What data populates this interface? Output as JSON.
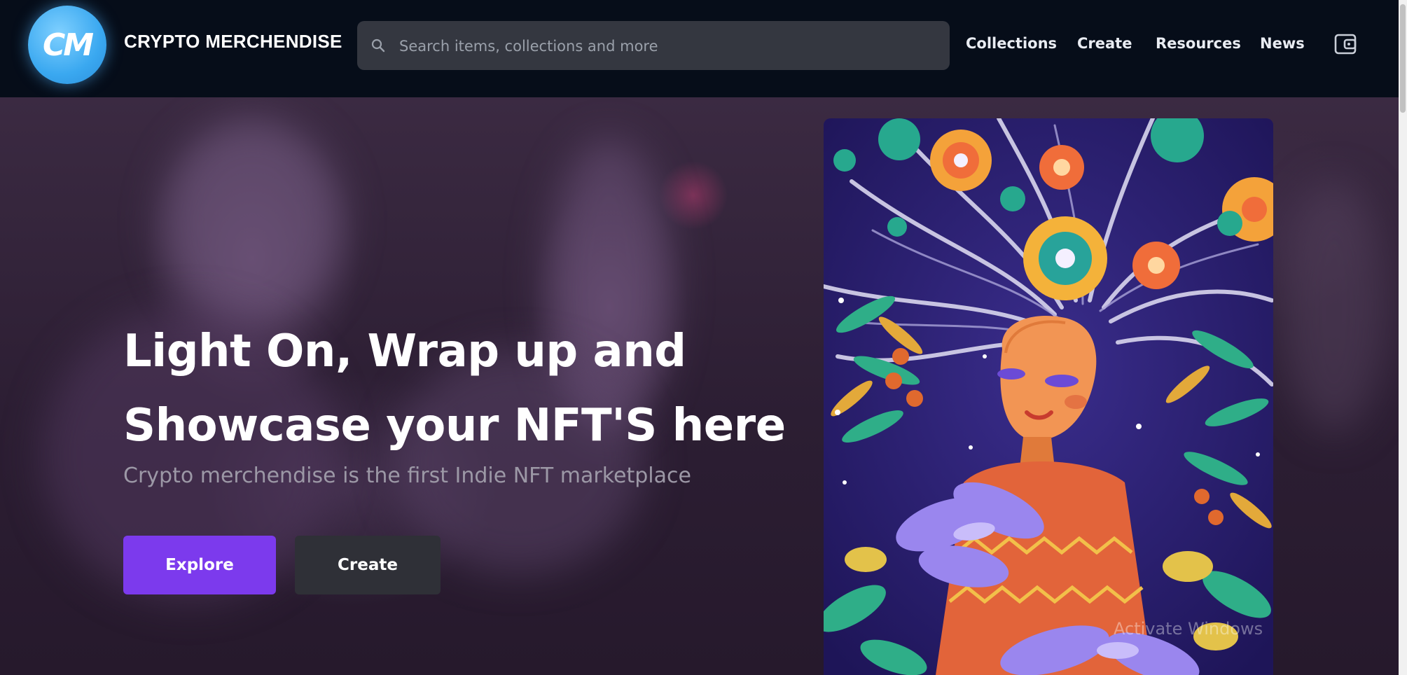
{
  "header": {
    "logo_text": "CM",
    "brand": "CRYPTO MERCHENDISE",
    "search": {
      "placeholder": "Search items, collections and more",
      "value": ""
    },
    "nav": [
      {
        "label": "Collections"
      },
      {
        "label": "Create"
      },
      {
        "label": "Resources"
      },
      {
        "label": "News"
      }
    ]
  },
  "hero": {
    "headline_line1": "Light On, Wrap up and",
    "headline_line2": "Showcase your NFT'S here",
    "subtitle": "Crypto merchendise is the first Indie NFT marketplace",
    "explore_label": "Explore",
    "create_label": "Create"
  },
  "overlay": {
    "watermark": "Activate Windows"
  },
  "colors": {
    "navbar": "#060d19",
    "accent": "#7c3aed",
    "secondary_button": "#2f3037",
    "logo": "#3aa8f0",
    "search_bg": "#343740"
  },
  "icons": {
    "search": "search-icon",
    "wallet": "wallet-icon"
  }
}
